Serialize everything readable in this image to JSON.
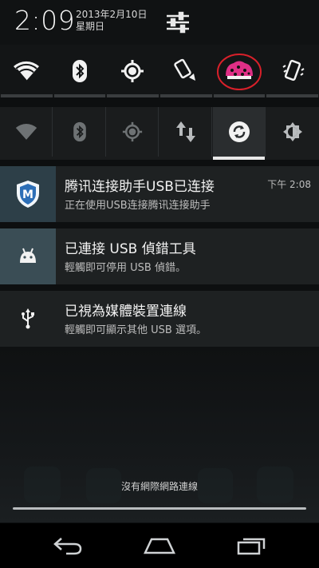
{
  "status": {
    "clock": "2:09",
    "date": "2013年2月10日",
    "weekday": "星期日"
  },
  "quick_toggles_row1": [
    {
      "icon": "wifi-icon"
    },
    {
      "icon": "bluetooth-icon"
    },
    {
      "icon": "gps-icon"
    },
    {
      "icon": "rotate-phone-icon"
    },
    {
      "icon": "app-widget-icon"
    },
    {
      "icon": "vibrate-phone-icon"
    }
  ],
  "quick_toggles_row2": [
    {
      "icon": "wifi-icon",
      "active": false
    },
    {
      "icon": "bluetooth-icon",
      "active": false
    },
    {
      "icon": "gps-icon",
      "active": false
    },
    {
      "icon": "mobile-data-icon",
      "active": false
    },
    {
      "icon": "sync-icon",
      "active": true
    },
    {
      "icon": "brightness-icon",
      "active": false
    }
  ],
  "notifications": [
    {
      "title": "腾讯连接助手USB已连接",
      "subtitle": "正在使用USB连接腾讯连接助手",
      "time": "下午 2:08",
      "icon": "tencent-shield-icon",
      "icon_letter": "M"
    },
    {
      "title": "已連接 USB 偵錯工具",
      "subtitle": "輕觸即可停用 USB 偵錯。",
      "icon": "android-debug-icon"
    },
    {
      "title": "已視為媒體裝置連線",
      "subtitle": "輕觸即可顯示其他 USB 選項。",
      "icon": "usb-icon"
    }
  ],
  "footer": {
    "no_network": "沒有網際網路連線"
  },
  "navbar": {
    "back": "back-icon",
    "home": "home-icon",
    "recents": "recents-icon"
  },
  "colors": {
    "accent_active": "#e8e8e8",
    "tencent_blue": "#2d6fb7",
    "icon_tile": "#3a4d55",
    "annotation_red": "#d8202a"
  }
}
